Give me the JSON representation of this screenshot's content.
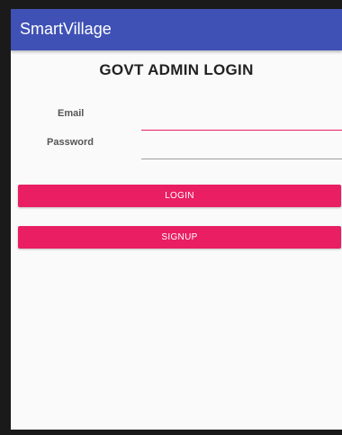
{
  "app_bar": {
    "title": "SmartVillage"
  },
  "page": {
    "title": "GOVT ADMIN LOGIN"
  },
  "form": {
    "email_label": "Email",
    "email_value": "",
    "password_label": "Password",
    "password_value": ""
  },
  "buttons": {
    "login_label": "LOGIN",
    "signup_label": "SIGNUP"
  },
  "colors": {
    "app_bar": "#3f51b5",
    "accent": "#e91e63"
  }
}
